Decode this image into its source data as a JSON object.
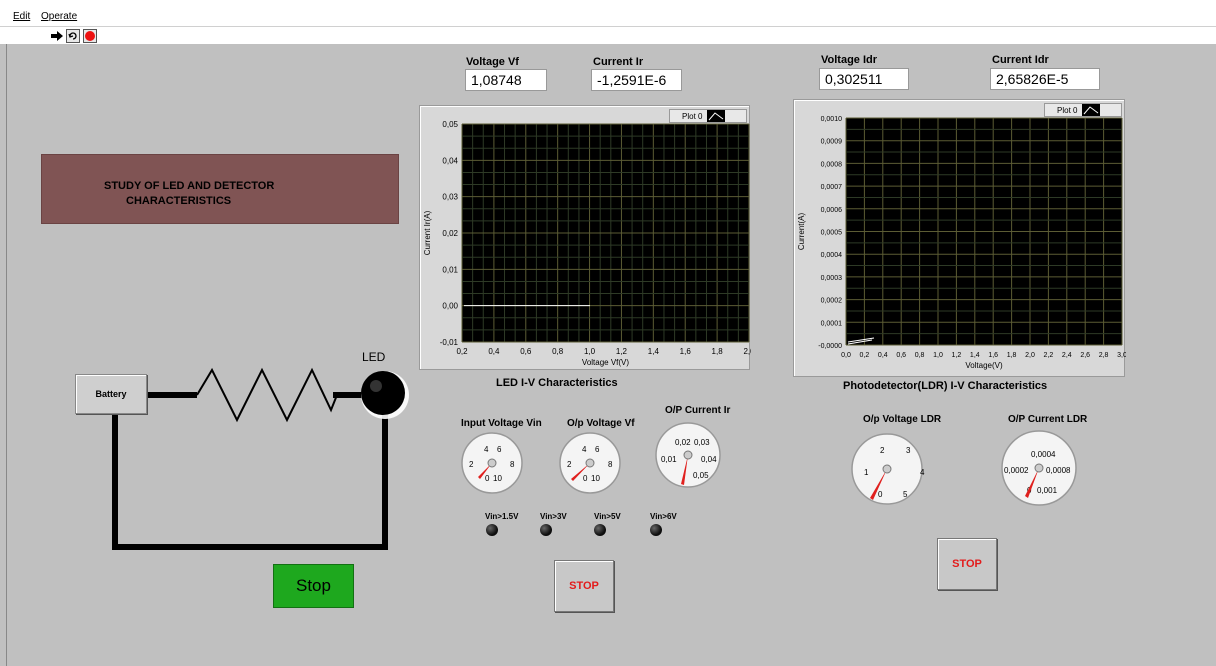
{
  "menu": {
    "edit": "Edit",
    "operate": "Operate"
  },
  "toolbar": {
    "run_icon": "run-arrow-icon",
    "continuous_icon": "run-continuously-icon",
    "abort_icon": "abort-icon"
  },
  "title": {
    "line1": "STUDY OF LED AND DETECTOR",
    "line2": "CHARACTERISTICS"
  },
  "indicators": {
    "vf": {
      "label": "Voltage Vf",
      "value": "1,08748"
    },
    "ir": {
      "label": "Current Ir",
      "value": "-1,2591E-6"
    },
    "vldr": {
      "label": "Voltage Idr",
      "value": "0,302511"
    },
    "ildr": {
      "label": "Current Idr",
      "value": "2,65826E-5"
    }
  },
  "led_graph": {
    "legend": "Plot 0",
    "title": "LED I-V Characteristics",
    "xlabel": "Voltage Vf(V)",
    "ylabel": "Current Ir(A)",
    "xticks": [
      "0,2",
      "0,4",
      "0,6",
      "0,8",
      "1,0",
      "1,2",
      "1,4",
      "1,6",
      "1,8",
      "2,0"
    ],
    "yticks": [
      "0,05",
      "0,04",
      "0,03",
      "0,02",
      "0,01",
      "0,00",
      "-0,01"
    ]
  },
  "ldr_graph": {
    "legend": "Plot 0",
    "title": "Photodetector(LDR) I-V Characteristics",
    "xlabel": "Voltage(V)",
    "ylabel": "Current(A)",
    "xticks": [
      "0,0",
      "0,2",
      "0,4",
      "0,6",
      "0,8",
      "1,0",
      "1,2",
      "1,4",
      "1,6",
      "1,8",
      "2,0",
      "2,2",
      "2,4",
      "2,6",
      "2,8",
      "3,0"
    ],
    "yticks": [
      "0,0010",
      "0,0009",
      "0,0008",
      "0,0007",
      "0,0006",
      "0,0005",
      "0,0004",
      "0,0003",
      "0,0002",
      "0,0001",
      "-0,0000"
    ]
  },
  "gauges": {
    "vin": {
      "label": "Input Voltage Vin",
      "ticks": [
        "4",
        "6",
        "2",
        "8",
        "0",
        "10"
      ]
    },
    "vf": {
      "label": "O/p Voltage Vf",
      "ticks": [
        "4",
        "6",
        "2",
        "8",
        "0",
        "10"
      ]
    },
    "ir": {
      "label": "O/P Current Ir",
      "ticks": [
        "0,02",
        "0,03",
        "0,01",
        "0,04",
        "0,05"
      ]
    },
    "vldr": {
      "label": "O/p Voltage LDR",
      "ticks": [
        "2",
        "3",
        "1",
        "4",
        "0",
        "5"
      ]
    },
    "ildr": {
      "label": "O/P Current LDR",
      "ticks": [
        "0,0004",
        "0,0002",
        "0,0008",
        "0",
        "0,001"
      ]
    }
  },
  "leds": [
    "Vin>1.5V",
    "Vin>3V",
    "Vin>5V",
    "Vin>6V"
  ],
  "buttons": {
    "stop1": "STOP",
    "stop2": "STOP",
    "stop_green": "Stop",
    "battery": "Battery"
  },
  "circuit": {
    "led_label": "LED"
  }
}
